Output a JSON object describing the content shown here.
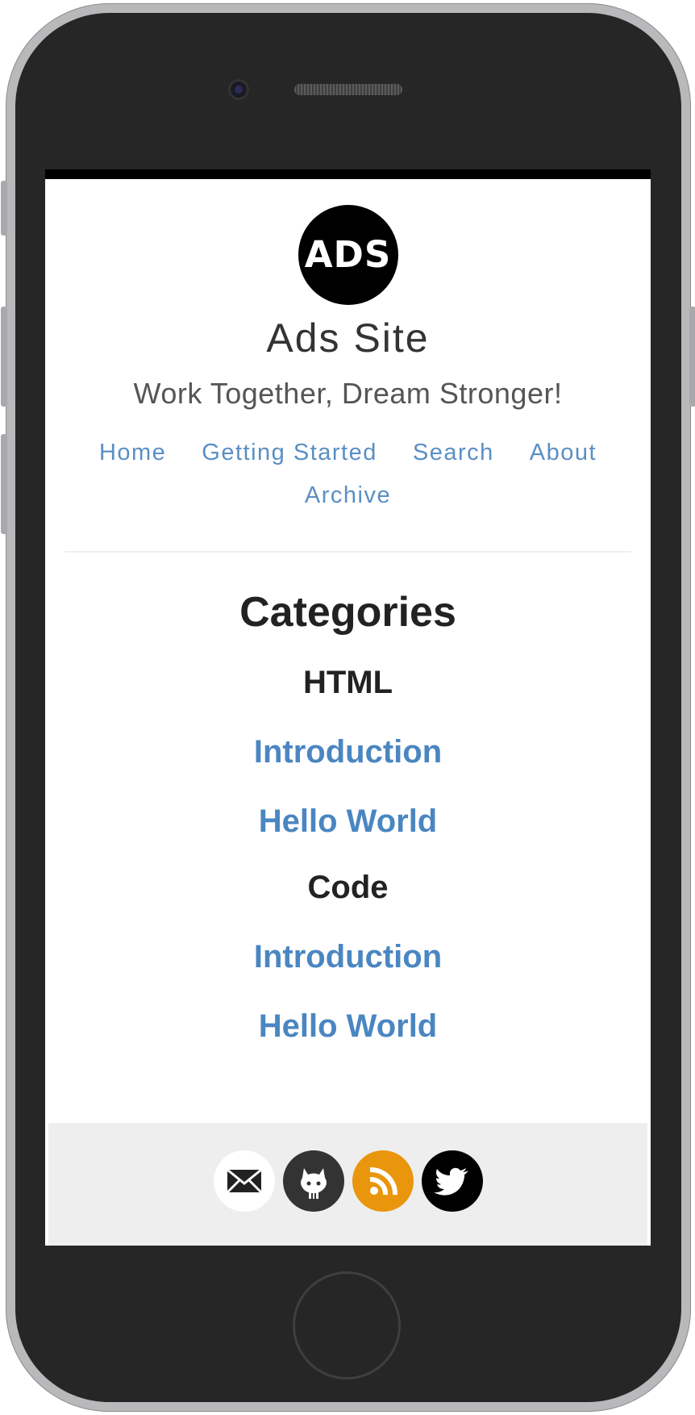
{
  "site": {
    "logo_text": "ADS",
    "title": "Ads Site",
    "tagline": "Work Together, Dream Stronger!"
  },
  "nav": {
    "items": [
      {
        "label": "Home"
      },
      {
        "label": "Getting Started"
      },
      {
        "label": "Search"
      },
      {
        "label": "About"
      },
      {
        "label": "Archive"
      }
    ]
  },
  "content": {
    "title": "Categories",
    "groups": [
      {
        "heading": "HTML",
        "links": [
          {
            "label": "Introduction"
          },
          {
            "label": "Hello World"
          }
        ]
      },
      {
        "heading": "Code",
        "links": [
          {
            "label": "Introduction"
          },
          {
            "label": "Hello World"
          }
        ]
      }
    ]
  },
  "footer": {
    "social": [
      {
        "icon": "email-icon",
        "color": "#ffffff"
      },
      {
        "icon": "github-icon",
        "color": "#333333"
      },
      {
        "icon": "rss-icon",
        "color": "#e9960c"
      },
      {
        "icon": "twitter-icon",
        "color": "#000000"
      }
    ]
  },
  "colors": {
    "link": "#4a86c1",
    "nav_link": "#5a8fc4",
    "footer_bg": "#eeeeee",
    "phone_body": "#262626"
  }
}
